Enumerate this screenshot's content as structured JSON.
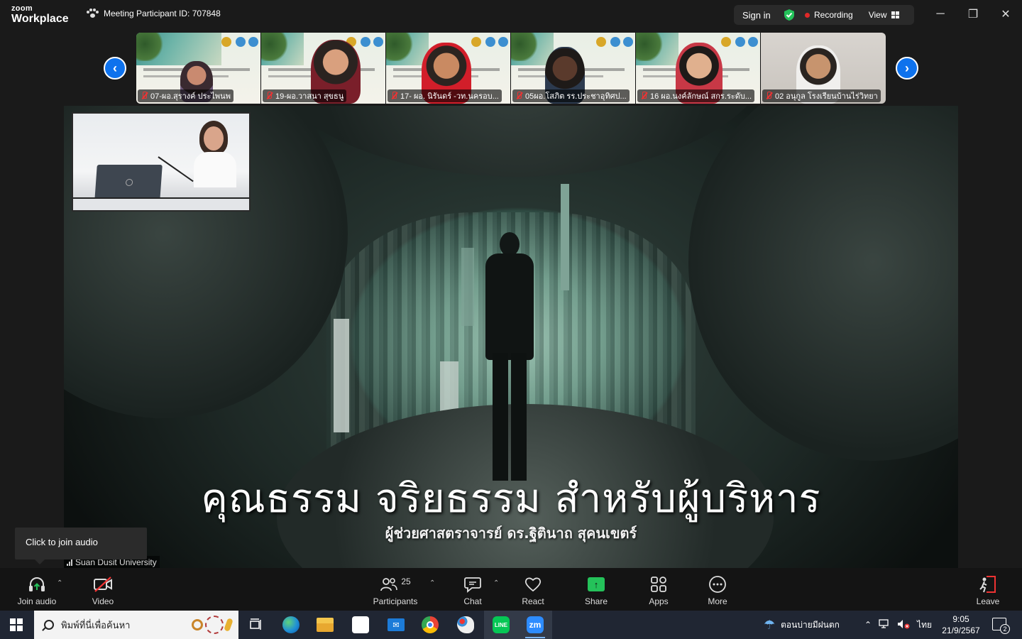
{
  "titlebar": {
    "logo_top": "zoom",
    "logo_bottom": "Workplace",
    "meeting_id": "Meeting Participant ID: 707848",
    "sign_in": "Sign in",
    "recording": "Recording",
    "view": "View",
    "minimize": "─",
    "maximize": "❐",
    "close": "✕"
  },
  "gallery": {
    "prev": "‹",
    "next": "›",
    "tiles": [
      {
        "name": "07-ผอ.สุรางค์ ประไพนพ"
      },
      {
        "name": "19-ผอ.วาสนา สุขธนู"
      },
      {
        "name": "17- ผอ. นิรันดร์ -วท.นครอบ..."
      },
      {
        "name": "05ผอ.โสภิต รร.ประชาอุทิศป..."
      },
      {
        "name": "16 ผอ.นงค์ลักษณ์ สกร.ระดับ..."
      },
      {
        "name": "02 อนุกูล โรงเรียนบ้านไร่วิทยา"
      }
    ]
  },
  "slide": {
    "title": "คุณธรรม จริยธรรม สำหรับผู้บริหาร",
    "subtitle": "ผู้ช่วยศาสตราจารย์ ดร.ฐิตินาถ สุคนเขตร์"
  },
  "tooltip": "Click to join audio",
  "speaker": "Suan Dusit University",
  "toolbar": {
    "join_audio": "Join audio",
    "video": "Video",
    "participants": "Participants",
    "participant_count": "25",
    "chat": "Chat",
    "react": "React",
    "share": "Share",
    "apps": "Apps",
    "more": "More",
    "leave": "Leave"
  },
  "taskbar": {
    "search_placeholder": "พิมพ์ที่นี่เพื่อค้นหา",
    "weather": "ตอนบ่ายมีฝนตก",
    "language": "ไทย",
    "time": "9:05",
    "date": "21/9/2567",
    "notifications": "2",
    "zoom_app": "zm",
    "line_app": "LINE"
  },
  "colors": {
    "accent": "#0e72ed",
    "recording": "#e02828",
    "share_green": "#24c25a",
    "leave_red": "#e33333"
  }
}
